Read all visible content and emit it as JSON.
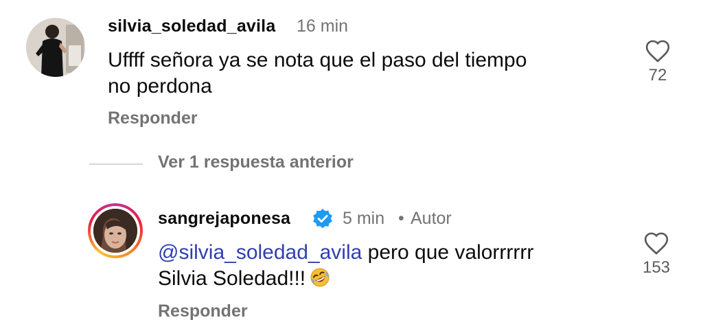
{
  "comments": [
    {
      "username": "silvia_soledad_avila",
      "time": "16 min",
      "text_line1": "Uffff señora ya se nota que el paso del tiempo",
      "text_line2": "no perdona",
      "like_count": "72",
      "reply_label": "Responder"
    },
    {
      "username": "sangrejaponesa",
      "time": "5 min",
      "separator": "•",
      "author_badge": "Autor",
      "mention": "@silvia_soledad_avila",
      "text_line1_rest": " pero que valorrrrrr",
      "text_line2": "Silvia Soledad!!!",
      "like_count": "153",
      "reply_label": "Responder"
    }
  ],
  "view_replies_label": "Ver 1 respuesta anterior",
  "icons": {
    "heart": "heart-icon",
    "verified": "verified-badge-icon",
    "emoji": "rolling-laughing-emoji"
  },
  "colors": {
    "mention": "#2f3fb0",
    "verified": "#1d9bf0",
    "muted": "#737373"
  }
}
